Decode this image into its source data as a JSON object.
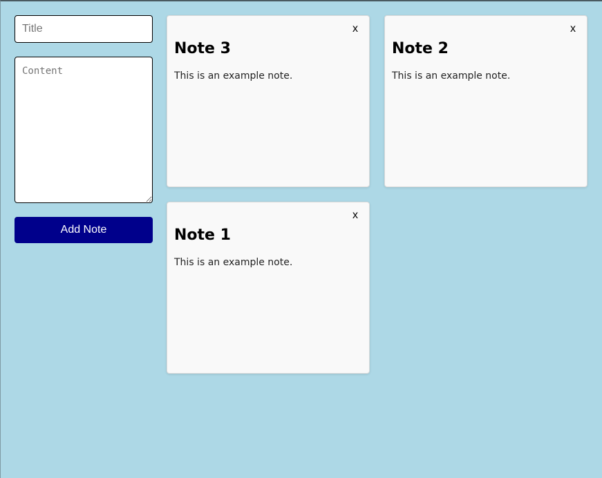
{
  "form": {
    "title_placeholder": "Title",
    "content_placeholder": "Content",
    "add_label": "Add Note"
  },
  "notes": [
    {
      "title": "Note 3",
      "body": "This is an example note.",
      "close_label": "x"
    },
    {
      "title": "Note 2",
      "body": "This is an example note.",
      "close_label": "x"
    },
    {
      "title": "Note 1",
      "body": "This is an example note.",
      "close_label": "x"
    }
  ],
  "colors": {
    "background": "#add8e6",
    "note_background": "#f9f9f9",
    "button_background": "#00008b",
    "button_text": "#ffffff"
  }
}
